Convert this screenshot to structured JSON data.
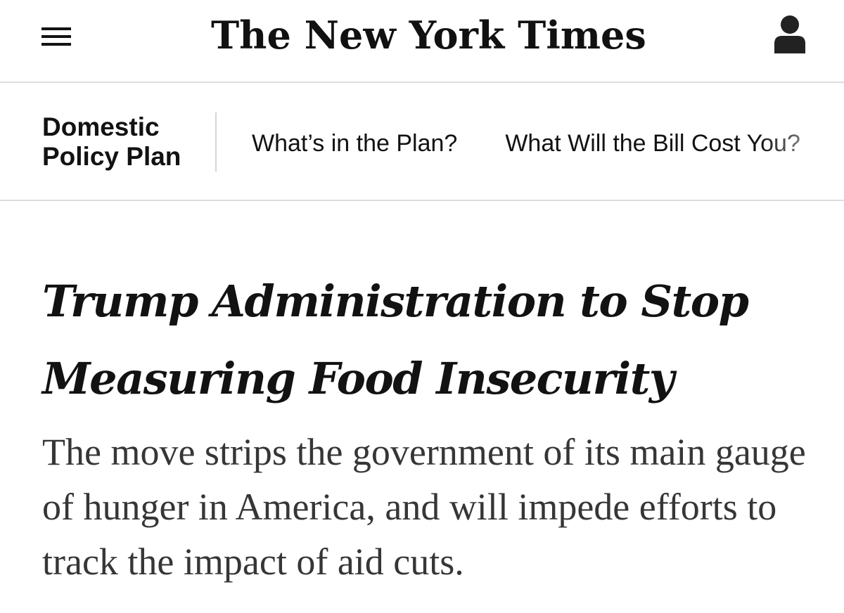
{
  "masthead": {
    "menu_icon": "hamburger-menu-icon",
    "logo_text": "The New York Times",
    "account_icon": "person-account-icon"
  },
  "section": {
    "name_line1": "Domestic",
    "name_line2": "Policy Plan",
    "links": [
      {
        "label": "What’s in the Plan?"
      },
      {
        "label": "What Will the Bill Cost You?"
      }
    ]
  },
  "article": {
    "headline": "Trump Administration to Stop Measuring Food Insecurity",
    "summary": "The move strips the government of its main gauge of hunger in America, and will impede efforts to track the impact of aid cuts."
  }
}
